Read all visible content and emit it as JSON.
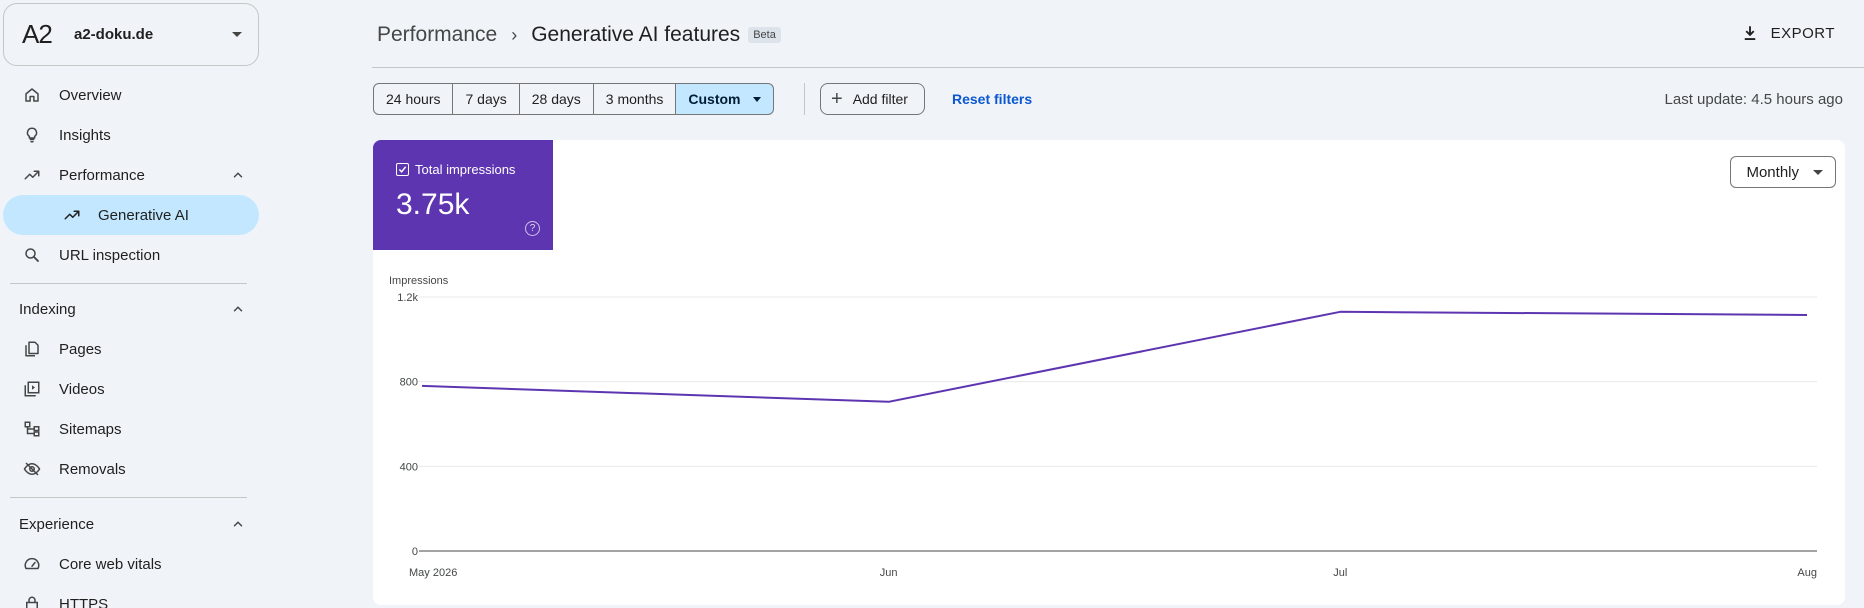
{
  "sidebar": {
    "property": {
      "logo": "A2",
      "name": "a2-doku.de"
    },
    "items": {
      "overview": "Overview",
      "insights": "Insights",
      "performance": "Performance",
      "generative_ai": "Generative AI",
      "url_inspection": "URL inspection"
    },
    "indexing": {
      "title": "Indexing",
      "pages": "Pages",
      "videos": "Videos",
      "sitemaps": "Sitemaps",
      "removals": "Removals"
    },
    "experience": {
      "title": "Experience",
      "core_web_vitals": "Core web vitals",
      "https": "HTTPS"
    }
  },
  "header": {
    "breadcrumb_parent": "Performance",
    "breadcrumb_current": "Generative AI features",
    "badge": "Beta",
    "export_label": "EXPORT"
  },
  "filters": {
    "ranges": [
      "24 hours",
      "7 days",
      "28 days",
      "3 months",
      "Custom"
    ],
    "selected": "Custom",
    "add_filter": "Add filter",
    "reset_filters": "Reset filters",
    "last_update": "Last update: 4.5 hours ago"
  },
  "metric": {
    "label": "Total impressions",
    "value": "3.75k",
    "help": "?",
    "color": "#5e35b1"
  },
  "interval": {
    "label": "Monthly"
  },
  "chart_data": {
    "type": "line",
    "ylabel": "Impressions",
    "x": [
      "May 2026",
      "Jun",
      "Jul",
      "Aug"
    ],
    "x_days": [
      0,
      31,
      61,
      92
    ],
    "series": [
      {
        "color": "#5e35b1",
        "values": [
          780,
          705,
          1130,
          1115
        ]
      }
    ],
    "ylim": [
      0,
      1200
    ],
    "yticks": [
      0,
      400,
      800,
      1200
    ],
    "ytick_labels": [
      "0",
      "400",
      "800",
      "1.2k"
    ],
    "grid": true
  }
}
